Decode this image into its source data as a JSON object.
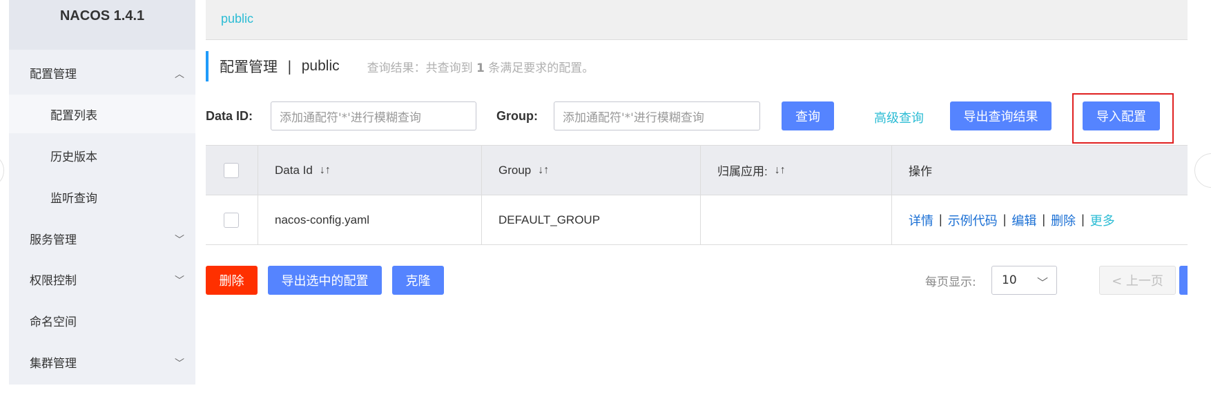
{
  "sidebar": {
    "title": "NACOS 1.4.1",
    "items": [
      {
        "label": "配置管理",
        "chevron": "up"
      },
      {
        "label": "配置列表"
      },
      {
        "label": "历史版本"
      },
      {
        "label": "监听查询"
      },
      {
        "label": "服务管理",
        "chevron": "down"
      },
      {
        "label": "权限控制",
        "chevron": "down"
      },
      {
        "label": "命名空间"
      },
      {
        "label": "集群管理",
        "chevron": "down"
      }
    ]
  },
  "topbar": {
    "namespace": "public"
  },
  "header": {
    "title": "配置管理",
    "separator": "|",
    "namespace": "public",
    "result_prefix": "查询结果：共查询到",
    "result_count": "1",
    "result_suffix": "条满足要求的配置。"
  },
  "search": {
    "dataid_label": "Data ID:",
    "dataid_placeholder": "添加通配符'*'进行模糊查询",
    "group_label": "Group:",
    "group_placeholder": "添加通配符'*'进行模糊查询",
    "query_button": "查询",
    "advanced_link": "高级查询",
    "export_button": "导出查询结果",
    "import_button": "导入配置"
  },
  "table": {
    "columns": [
      "Data Id",
      "Group",
      "归属应用:",
      "操作"
    ],
    "rows": [
      {
        "data_id": "nacos-config.yaml",
        "group": "DEFAULT_GROUP",
        "app": ""
      }
    ],
    "actions": [
      "详情",
      "示例代码",
      "编辑",
      "删除",
      "更多"
    ]
  },
  "footer": {
    "delete_button": "删除",
    "export_selected_button": "导出选中的配置",
    "clone_button": "克隆",
    "page_size_label": "每页显示:",
    "page_size_value": "10",
    "prev_button": "< 上一页"
  },
  "colors": {
    "primary": "#5584ff",
    "danger": "#ff3000",
    "link": "#2cbcd4",
    "highlight": "#e02020"
  }
}
